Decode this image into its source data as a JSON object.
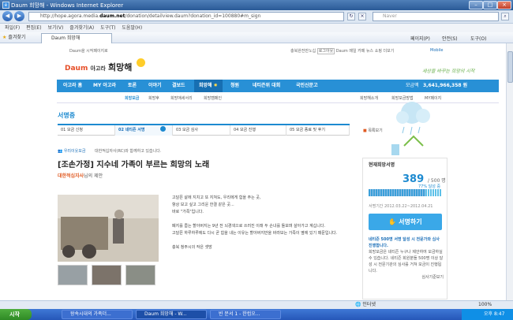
{
  "window": {
    "title": "Daum 희망해 - Windows Internet Explorer",
    "app_icon": "ie-icon"
  },
  "address": {
    "url_prefix": "http://hope.agora.media.",
    "url_domain": "daum.net",
    "url_suffix": "/donation/detailview.daum?donation_id=100880#m_sign",
    "search_placeholder": "Naver"
  },
  "menu": [
    "파일(F)",
    "편집(E)",
    "보기(V)",
    "즐겨찾기(A)",
    "도구(T)",
    "도움말(H)"
  ],
  "favorites": {
    "label": "즐겨찾기",
    "tab": "Daum 희망해"
  },
  "commands": [
    "페이지(P)",
    "안전(S)",
    "도구(O)"
  ],
  "page": {
    "top_left_link": "Daum을 시작페이지로",
    "top_right_links": [
      "충북완전만노십",
      "로그아웃",
      "Daum",
      "메일",
      "카페",
      "뉴스",
      "쇼핑",
      "더보기",
      "Mobile"
    ],
    "logo": {
      "brand": "Daum",
      "sub": "아고라",
      "name": "희망해"
    },
    "slogan": "세상을 바꾸는 희망의 시작",
    "nav": [
      "아고라 홈",
      "MY 아고라",
      "토론",
      "이야기",
      "결보드",
      "희망해",
      "청원",
      "네티즌위 대회",
      "국민신문고"
    ],
    "nav_total_label": "모금액",
    "nav_total": "3,641,966,358 원",
    "subnav_left": [
      "희망모금",
      "희망후",
      "희망애세서리",
      "희망캠페인"
    ],
    "subnav_right": [
      "희망해소개",
      "희망모금방법",
      "MY페이지"
    ],
    "status_heading": "서명중",
    "steps": [
      "01 모금 신청",
      "02 네티즌 서명",
      "03 모금 심사",
      "04 모금 진행",
      "05 모금 종료 및 후기"
    ],
    "bookmark": "목록보기",
    "org_tag": "우리이웃모금",
    "org_desc": "대한적십자사(RC)와 함께하고 있습니다.",
    "title": "[조손가정] 지수네 가족이 부르는 희망의 노래",
    "proposer_name": "대한적십자사",
    "proposer_suffix": "님의 제안",
    "body": [
      "고달픈 삶에 지치고 또 지쳐도, 우리에게 힘을 주는 곳,",
      "항상 보고 싶고 그리운 한결 같은 곳...",
      "바로 \"가족\"입니다.",
      "",
      "폐지를 줍는 할아버지는 9년 전 뇌경색으로 쓰러진 이래 두 손녀를 돌보며 살아가고 계십니다.",
      "고달픈 하루하루에도 다시 곧 힘을 내는 이유는 할아버지만을 바라보는 가족이 옆에 있기 때문입니다.",
      "",
      "충북 청주시의 작은 셋방"
    ],
    "sidebar": {
      "heading": "현재희망서명",
      "count": "389",
      "total": "/ 500 명",
      "percent": "77% 달성 중",
      "percent_value": 0.778,
      "period_label": "서명기간",
      "period": "2012.03.22~2012.04.21",
      "sign_button": "서명하기",
      "info_title": "네티즌 500명 서명 달성 시 전문가와 심사 진행합니다.",
      "info_text": "희망모금은 네티즌 누구나 제안하여 모금하실 수 있습니다. 네티즌 회원분들 500명 이상 달성 시 전문기관의 심사를 거쳐 모금이 진행됩니다.",
      "info_link": "심사기준보기"
    }
  },
  "statusbar": {
    "zone": "인터넷",
    "zoom": "100%"
  },
  "taskbar": {
    "start": "시작",
    "tasks": [
      "왕속시대의 가족더...",
      "Daum 희망해 - W...",
      "빈 문서 1 - 한컴오..."
    ],
    "clock": "오후 8:47"
  }
}
